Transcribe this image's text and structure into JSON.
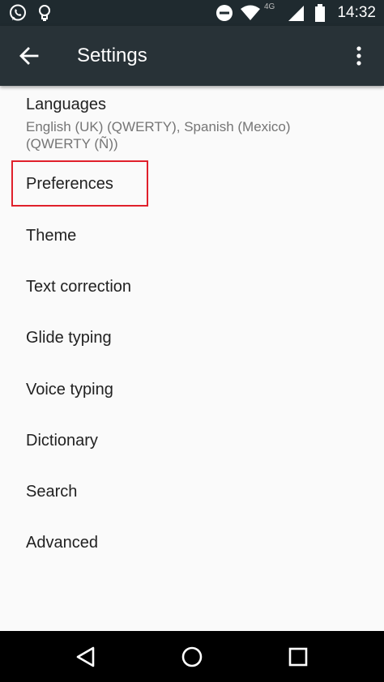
{
  "status_bar": {
    "time": "14:32",
    "network": "4G",
    "icons": [
      "whatsapp-icon",
      "lightbulb-icon",
      "do-not-disturb-icon",
      "wifi-icon",
      "cell-signal-icon",
      "battery-icon"
    ]
  },
  "app_bar": {
    "title": "Settings",
    "icons": [
      "back-arrow-icon",
      "overflow-menu-icon"
    ]
  },
  "settings": {
    "languages": {
      "title": "Languages",
      "summary": "English (UK) (QWERTY), Spanish (Mexico) (QWERTY (Ñ))"
    },
    "preferences": "Preferences",
    "theme": "Theme",
    "text_correction": "Text correction",
    "glide_typing": "Glide typing",
    "voice_typing": "Voice typing",
    "dictionary": "Dictionary",
    "search": "Search",
    "advanced": "Advanced"
  },
  "colors": {
    "status_bar": "#1f2a2f",
    "app_bar": "#283237",
    "background": "#fafafa",
    "highlight": "#e0202b",
    "nav_bar": "#000000"
  },
  "nav_bar": {
    "icons": [
      "back-triangle-icon",
      "home-circle-icon",
      "recents-square-icon"
    ]
  }
}
